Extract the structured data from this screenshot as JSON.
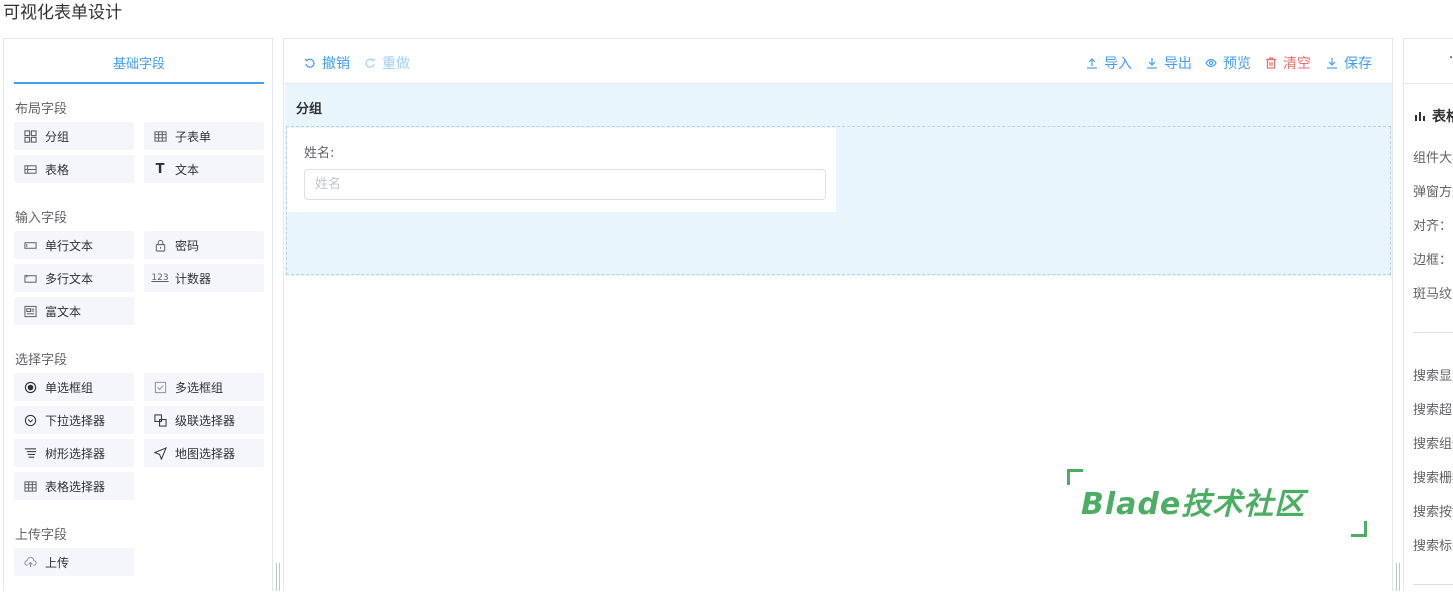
{
  "page": {
    "title": "可视化表单设计"
  },
  "left_panel": {
    "tab": "基础字段",
    "groups": [
      {
        "title": "布局字段",
        "items": [
          {
            "label": "分组",
            "icon": "grid-icon"
          },
          {
            "label": "子表单",
            "icon": "table-icon"
          },
          {
            "label": "表格",
            "icon": "list-table-icon"
          },
          {
            "label": "文本",
            "icon": "text-t-icon"
          }
        ]
      },
      {
        "title": "输入字段",
        "items": [
          {
            "label": "单行文本",
            "icon": "input-single-icon"
          },
          {
            "label": "密码",
            "icon": "lock-icon"
          },
          {
            "label": "多行文本",
            "icon": "input-multi-icon"
          },
          {
            "label": "计数器",
            "icon": "counter-icon",
            "glyph": "123"
          },
          {
            "label": "富文本",
            "icon": "rich-text-icon"
          }
        ]
      },
      {
        "title": "选择字段",
        "items": [
          {
            "label": "单选框组",
            "icon": "radio-icon"
          },
          {
            "label": "多选框组",
            "icon": "checkbox-icon"
          },
          {
            "label": "下拉选择器",
            "icon": "select-icon"
          },
          {
            "label": "级联选择器",
            "icon": "cascader-icon"
          },
          {
            "label": "树形选择器",
            "icon": "tree-icon"
          },
          {
            "label": "地图选择器",
            "icon": "map-pin-icon"
          },
          {
            "label": "表格选择器",
            "icon": "table-select-icon"
          }
        ]
      },
      {
        "title": "上传字段",
        "items": [
          {
            "label": "上传",
            "icon": "cloud-upload-icon"
          }
        ]
      }
    ]
  },
  "toolbar": {
    "undo": "撤销",
    "redo": "重做",
    "import": "导入",
    "export": "导出",
    "preview": "预览",
    "clear": "清空",
    "save": "保存"
  },
  "canvas": {
    "group_label": "分组",
    "field_label": "姓名:",
    "field_placeholder": "姓名"
  },
  "watermark": "Blade技术社区",
  "right_panel": {
    "section_title": "表格",
    "rows_top": [
      "组件大小",
      "弹窗方式",
      "对齐：",
      "边框：",
      "斑马纹"
    ],
    "rows_bottom": [
      "搜索显示",
      "搜索超出",
      "搜索组件",
      "搜索栅格",
      "搜索按钮",
      "搜索标签"
    ]
  },
  "colors": {
    "primary": "#409eff",
    "danger": "#f56c6c",
    "group_bg": "#e8f5fd",
    "field_bg": "#f4f6fc",
    "watermark": "#4cae63"
  }
}
